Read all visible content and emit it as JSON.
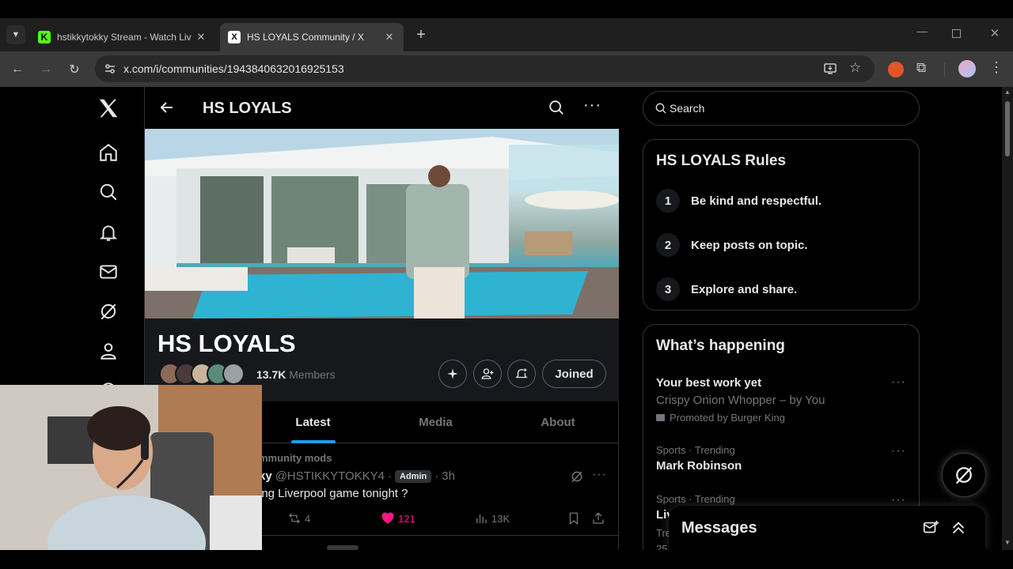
{
  "browser": {
    "tabs": [
      {
        "title": "hstikkytokky Stream - Watch Liv",
        "favicon": "kick-icon",
        "active": false
      },
      {
        "title": "HS LOYALS Community / X",
        "favicon": "x-icon",
        "active": true
      }
    ],
    "url": "x.com/i/communities/1943840632016925153"
  },
  "community": {
    "header_title": "HS LOYALS",
    "name": "HS LOYALS",
    "member_count": "13.7K",
    "members_label": "Members",
    "joined_label": "Joined",
    "tabs": [
      "Latest",
      "Media",
      "About"
    ],
    "active_tab": "Latest"
  },
  "post": {
    "context": "mmunity mods",
    "author_partial": "ky",
    "handle": "@HSTIKKYTOKKY4",
    "badge": "Admin",
    "separator": "·",
    "time": "3h",
    "text": "ing Liverpool game tonight ?",
    "reposts": "4",
    "likes": "121",
    "views": "13K"
  },
  "sidebar_right": {
    "search_placeholder": "Search",
    "rules_title": "HS LOYALS Rules",
    "rules": [
      {
        "num": "1",
        "text": "Be kind and respectful."
      },
      {
        "num": "2",
        "text": "Keep posts on topic."
      },
      {
        "num": "3",
        "text": "Explore and share."
      }
    ],
    "happening_title": "What’s happening",
    "trends": [
      {
        "title": "Your best work yet",
        "sub": "Crispy Onion Whopper – by You",
        "promo": "Promoted by Burger King"
      },
      {
        "meta": "Sports · Trending",
        "title": "Mark Robinson"
      },
      {
        "meta": "Sports · Trending",
        "title": "Liv",
        "extra": "Tre",
        "extra2": "25"
      }
    ]
  },
  "messages": {
    "title": "Messages"
  },
  "colors": {
    "like": "#f91880",
    "accent": "#1d9bf0",
    "border": "#2f3336"
  }
}
